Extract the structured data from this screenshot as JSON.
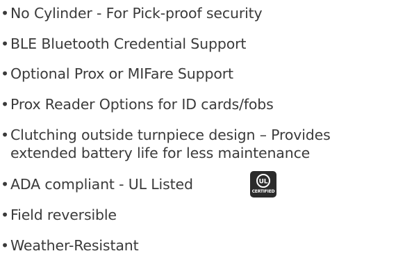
{
  "features": [
    "No Cylinder - For Pick-proof security",
    "BLE Bluetooth Credential Support",
    "Optional Prox or MIFare Support",
    "Prox Reader Options for ID cards/fobs",
    "Clutching outside turnpiece design – Provides",
    "extended battery life for less maintenance",
    "ADA compliant - UL Listed",
    "Field reversible",
    "Weather-Resistant"
  ],
  "bullet": "•",
  "certification": {
    "mark": "UL",
    "label": "CERTIFIED",
    "icon": "ul-certified-badge-icon",
    "badge_color": "#2b2b2b"
  },
  "colors": {
    "text": "#3a3a3a",
    "background": "#ffffff"
  }
}
